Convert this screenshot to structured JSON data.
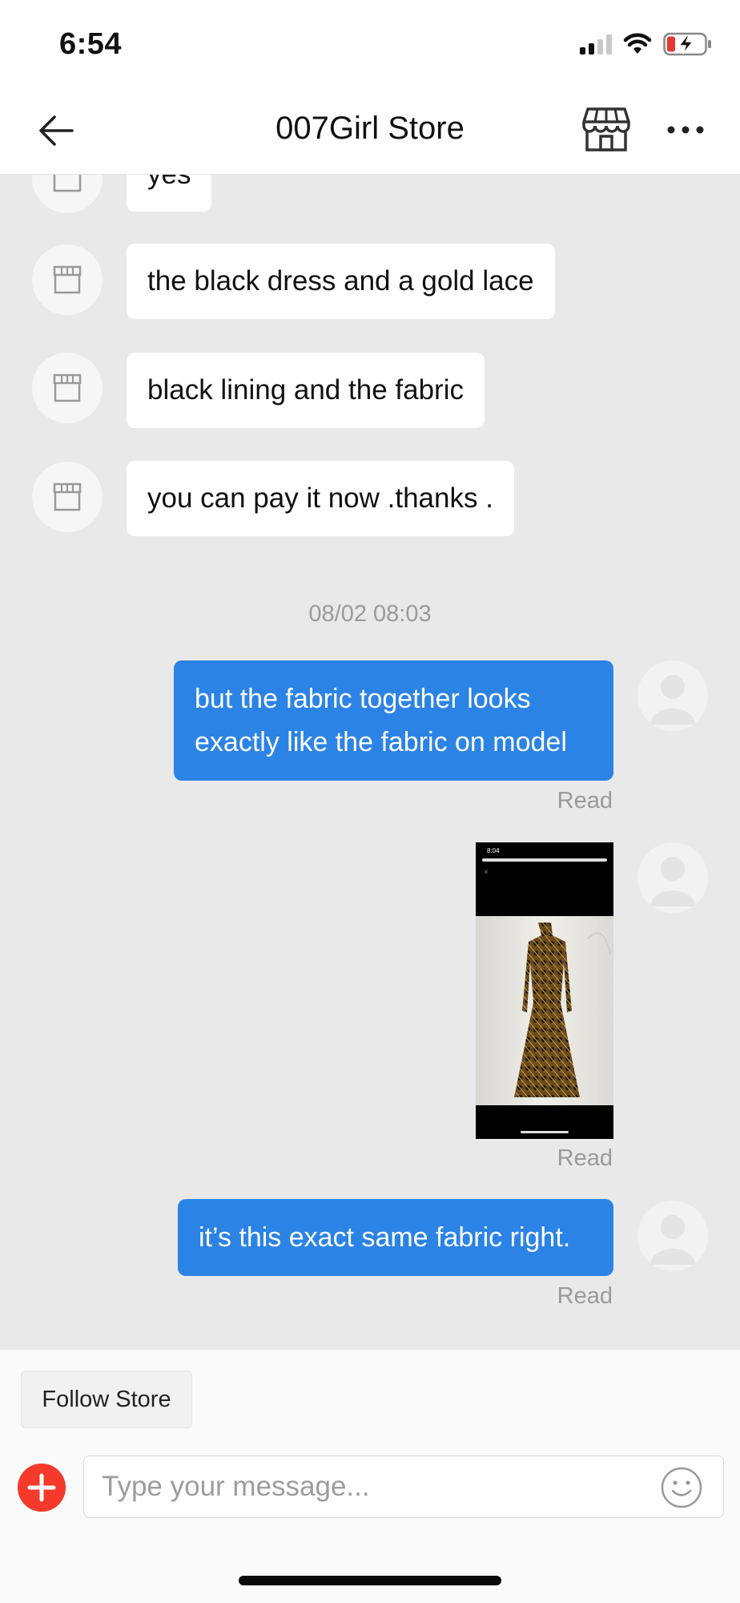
{
  "status_bar": {
    "time": "6:54"
  },
  "header": {
    "title": "007Girl Store"
  },
  "messages_in": [
    {
      "text": "yes"
    },
    {
      "text": "the black dress and a gold lace"
    },
    {
      "text": "black lining and the fabric"
    },
    {
      "text": "you can pay it now .thanks ."
    }
  ],
  "timestamp": "08/02 08:03",
  "messages_out": [
    {
      "line1": "but the fabric together looks",
      "line2": "exactly like the fabric on model",
      "status": "Read"
    },
    {
      "status": "Read"
    },
    {
      "text": "it’s this exact same fabric right.",
      "status": "Read"
    }
  ],
  "image_message": {
    "time": "8:04"
  },
  "bottom": {
    "follow_label": "Follow Store",
    "input_placeholder": "Type your message...",
    "input_value": ""
  },
  "colors": {
    "accent_blue": "#2b83e6",
    "chat_background": "#e9e9e9",
    "add_button_red": "#f5392b"
  }
}
